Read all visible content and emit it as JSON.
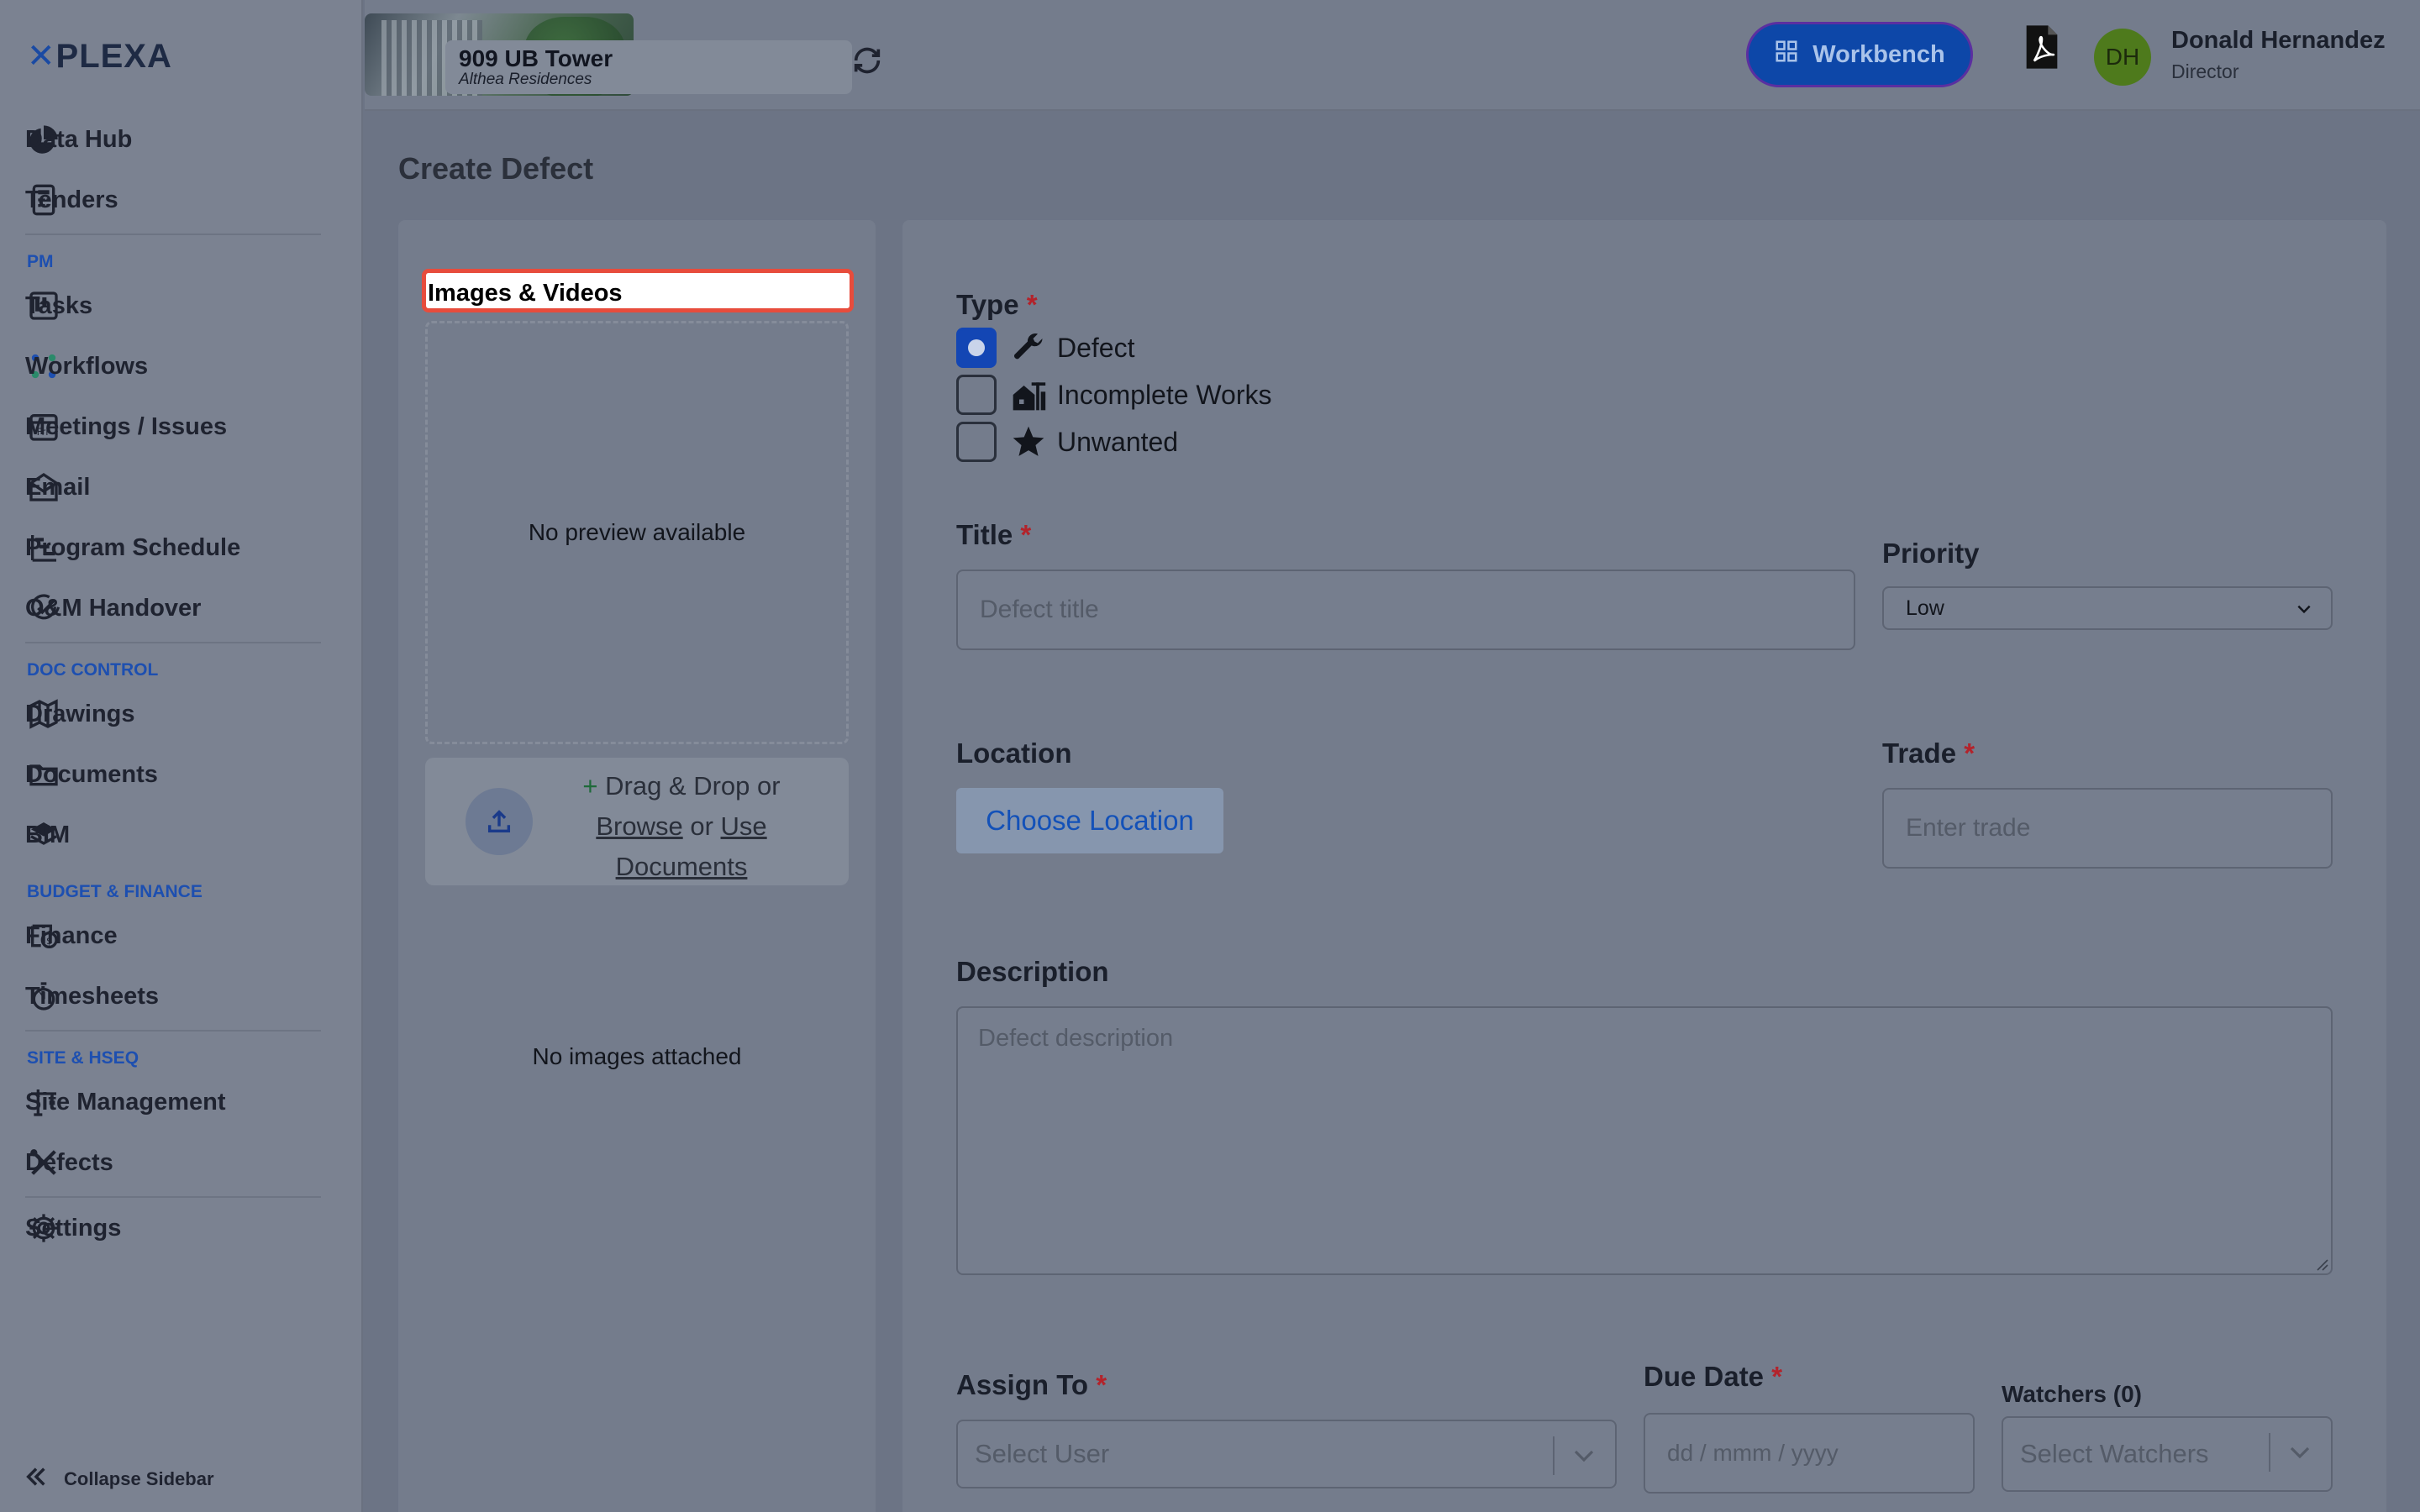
{
  "app": {
    "logo": "PLEXA"
  },
  "sidebar": {
    "items_top": [
      {
        "label": "Data Hub",
        "icon": "pie-chart-icon"
      },
      {
        "label": "Tenders",
        "icon": "calculator-icon"
      }
    ],
    "sections": [
      {
        "title": "PM",
        "items": [
          {
            "label": "Tasks",
            "icon": "kanban-icon"
          },
          {
            "label": "Workflows",
            "icon": "workflow-icon"
          },
          {
            "label": "Meetings / Issues",
            "icon": "calendar-icon"
          },
          {
            "label": "Email",
            "icon": "envelope-icon"
          },
          {
            "label": "Program Schedule",
            "icon": "gantt-icon"
          },
          {
            "label": "O&M Handover",
            "icon": "check-circle-icon"
          }
        ]
      },
      {
        "title": "DOC CONTROL",
        "items": [
          {
            "label": "Drawings",
            "icon": "map-icon"
          },
          {
            "label": "Documents",
            "icon": "folder-icon"
          },
          {
            "label": "BIM",
            "icon": "layers-icon"
          }
        ]
      },
      {
        "title": "BUDGET & FINANCE",
        "items": [
          {
            "label": "Finance",
            "icon": "finance-icon"
          },
          {
            "label": "Timesheets",
            "icon": "stopwatch-icon"
          }
        ]
      },
      {
        "title": "SITE & HSEQ",
        "items": [
          {
            "label": "Site Management",
            "icon": "crane-icon"
          },
          {
            "label": "Defects",
            "icon": "tools-icon"
          }
        ]
      }
    ],
    "settings": {
      "label": "Settings",
      "icon": "gear-icon"
    },
    "collapse_label": "Collapse Sidebar"
  },
  "header": {
    "project_name": "909 UB Tower",
    "project_sub": "Althea Residences",
    "workbench_label": "Workbench",
    "user_initials": "DH",
    "user_name": "Donald Hernandez",
    "user_role": "Director"
  },
  "page": {
    "title": "Create Defect"
  },
  "media": {
    "title": "Images & Videos",
    "preview_text": "No preview available",
    "drop_plus": "+",
    "drop_text": "Drag & Drop or",
    "browse": "Browse",
    "or": "or",
    "use_documents": "Use Documents",
    "no_images": "No images attached"
  },
  "form": {
    "type_label": "Type",
    "types": [
      {
        "label": "Defect",
        "checked": true
      },
      {
        "label": "Incomplete Works",
        "checked": false
      },
      {
        "label": "Unwanted",
        "checked": false
      }
    ],
    "title_label": "Title",
    "title_placeholder": "Defect title",
    "priority_label": "Priority",
    "priority_value": "Low",
    "location_label": "Location",
    "choose_location": "Choose Location",
    "trade_label": "Trade",
    "trade_placeholder": "Enter trade",
    "description_label": "Description",
    "description_placeholder": "Defect description",
    "assign_label": "Assign To",
    "assign_placeholder": "Select User",
    "due_label": "Due Date",
    "due_placeholder": "dd / mmm / yyyy",
    "watchers_label": "Watchers (0)",
    "watchers_placeholder": "Select Watchers",
    "required_mark": "*"
  }
}
